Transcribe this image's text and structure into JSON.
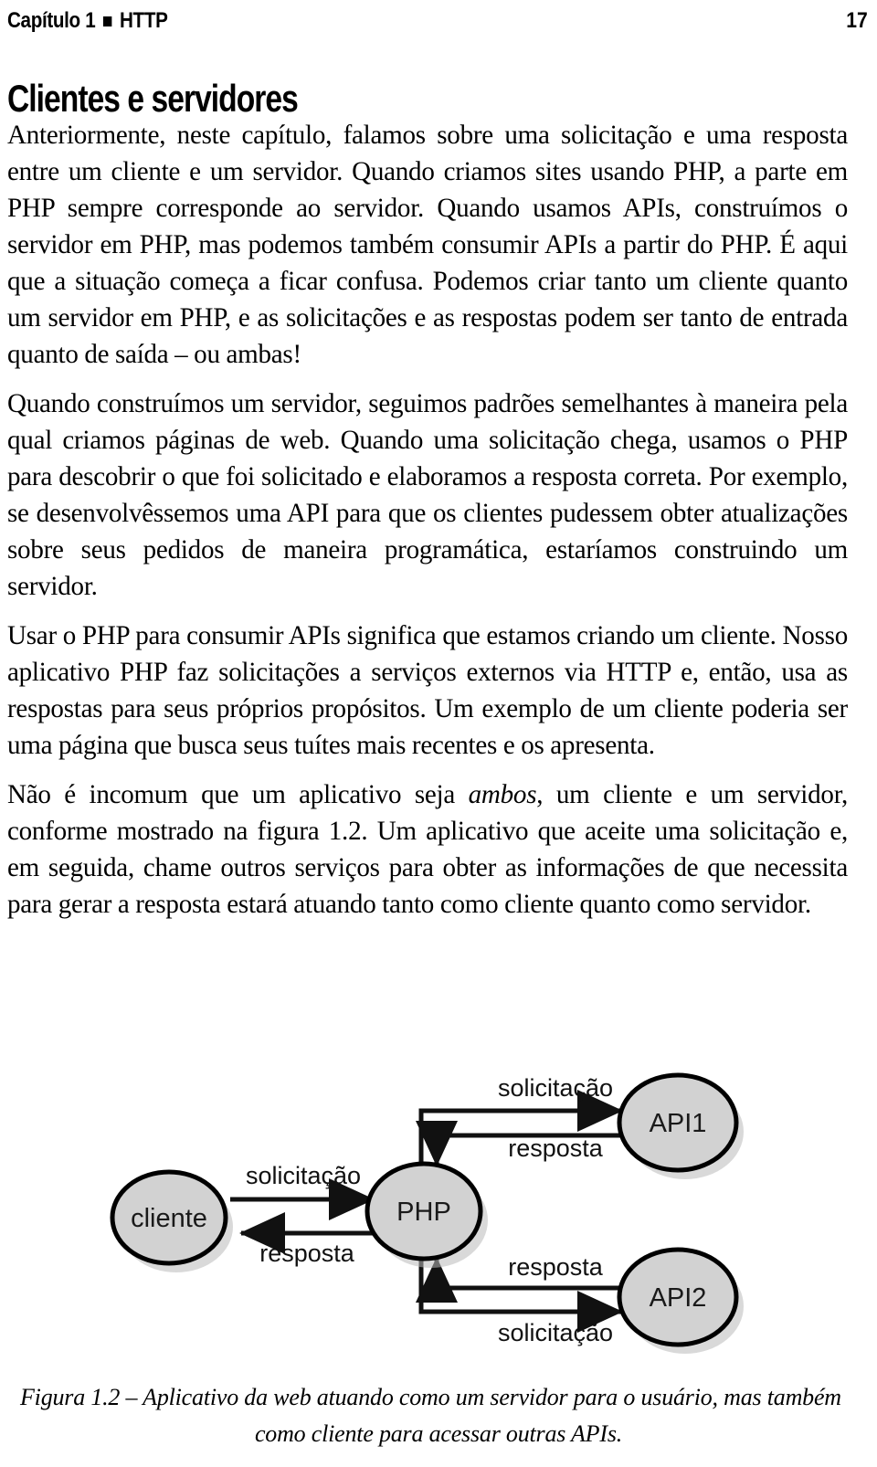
{
  "running_head": {
    "chapter_label": "Capítulo 1",
    "separator_icon": "square-bullet",
    "title": "HTTP",
    "page_number": "17"
  },
  "section": {
    "heading": "Clientes e servidores"
  },
  "paragraphs": {
    "p1_a": "Anteriormente, neste capítulo, falamos sobre uma solicitação e uma resposta entre um cliente e um servidor. Quando criamos sites usando PHP, a parte em PHP sempre corresponde ao servidor. Quando usamos APIs, construímos o servidor em PHP, mas podemos também consumir APIs a partir do PHP. É aqui que a situação começa a ficar confusa. Podemos criar tanto um cliente quanto um servidor em PHP, e as solicitações e as respostas podem ser tanto de entrada quanto de saída – ou ambas!",
    "p2": "Quando construímos um servidor, seguimos padrões semelhantes à maneira pela qual criamos páginas de web. Quando uma solicitação chega, usamos o PHP para descobrir o que foi solicitado e elaboramos a resposta correta. Por exemplo, se desenvolvêssemos uma API para que os clientes pudessem obter atualizações sobre seus pedidos de maneira programática, estaríamos construindo um servidor.",
    "p3": "Usar o PHP para consumir APIs significa que estamos criando um cliente. Nosso aplicativo PHP faz solicitações a serviços externos via HTTP e, então, usa as respostas para seus próprios propósitos. Um exemplo de um cliente poderia ser uma página que busca seus tuítes mais recentes e os apresenta.",
    "p4_before_italic": "Não é incomum que um aplicativo seja ",
    "p4_italic": "ambos",
    "p4_after_italic": ", um cliente e um servidor, conforme mostrado na figura 1.2. Um aplicativo que aceite uma solicitação e, em seguida, chame outros serviços para obter as informações de que necessita para gerar a resposta estará atuando tanto como cliente quanto como servidor."
  },
  "figure": {
    "nodes": {
      "client": "cliente",
      "php": "PHP",
      "api1": "API1",
      "api2": "API2"
    },
    "edges": {
      "client_to_php": "solicitação",
      "php_to_client": "resposta",
      "php_to_api1": "solicitação",
      "api1_to_php": "resposta",
      "api2_to_php": "resposta",
      "php_to_api2": "solicitação"
    },
    "colors": {
      "node_fill": "#d2d2d2",
      "node_stroke": "#000000",
      "edge_stroke": "#111111",
      "shadow": "#b9b9b9"
    }
  },
  "caption": {
    "line1": "Figura 1.2 – Aplicativo da web atuando como um servidor para o usuário, mas também",
    "line2": "como cliente para acessar outras APIs."
  }
}
